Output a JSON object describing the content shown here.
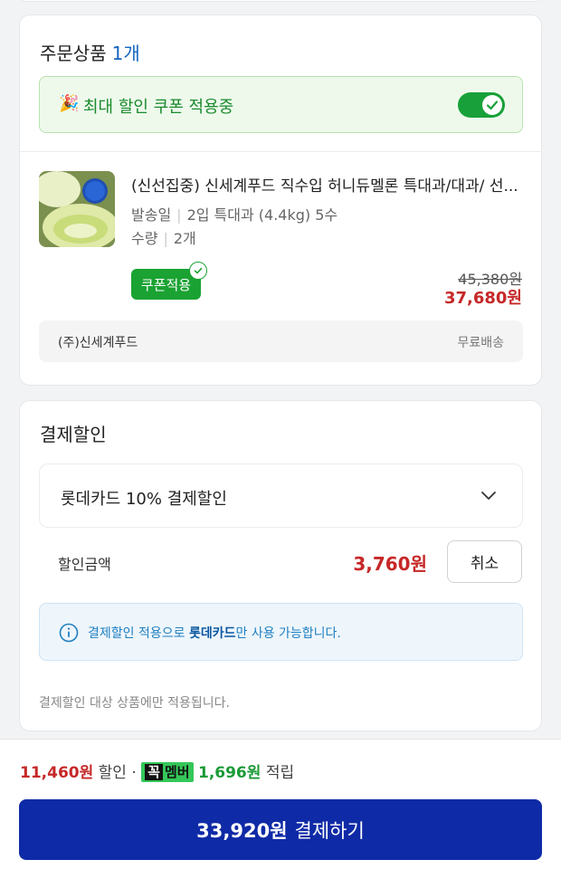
{
  "order": {
    "title": "주문상품",
    "count": "1개",
    "coupon_banner": "최대 할인 쿠폰 적용중",
    "coupon_toggle_on": true,
    "product": {
      "name": "(신선집중) 신세계푸드 직수입 허니듀멜론 특대과/대과/ 선...",
      "ship_label": "발송일",
      "ship_value": "2입 특대과 (4.4kg) 5수",
      "qty_label": "수량",
      "qty_value": "2개",
      "badge": "쿠폰적용",
      "original_price": "45,380원",
      "sale_price": "37,680원"
    },
    "seller": {
      "name": "(주)신세계푸드",
      "shipping": "무료배송"
    }
  },
  "payment_discount": {
    "title": "결제할인",
    "selected_option": "롯데카드 10% 결제할인",
    "amount_label": "할인금액",
    "amount_value": "3,760원",
    "cancel_label": "취소",
    "info_prefix": "결제할인 적용으로 ",
    "info_card": "롯데카드",
    "info_suffix": "만 사용 가능합니다.",
    "note": "결제할인 대상 상품에만 적용됩니다."
  },
  "summary": {
    "discount_amount": "11,460원",
    "discount_label": "할인",
    "member_badge_first": "꼭",
    "member_badge_rest": "멤버",
    "points_amount": "1,696원",
    "points_label": "적립"
  },
  "pay_button": {
    "amount": "33,920원",
    "label": "결제하기"
  },
  "colors": {
    "accent_blue": "#0f2aa6",
    "sale_red": "#c62828",
    "coupon_green": "#1aa232"
  }
}
